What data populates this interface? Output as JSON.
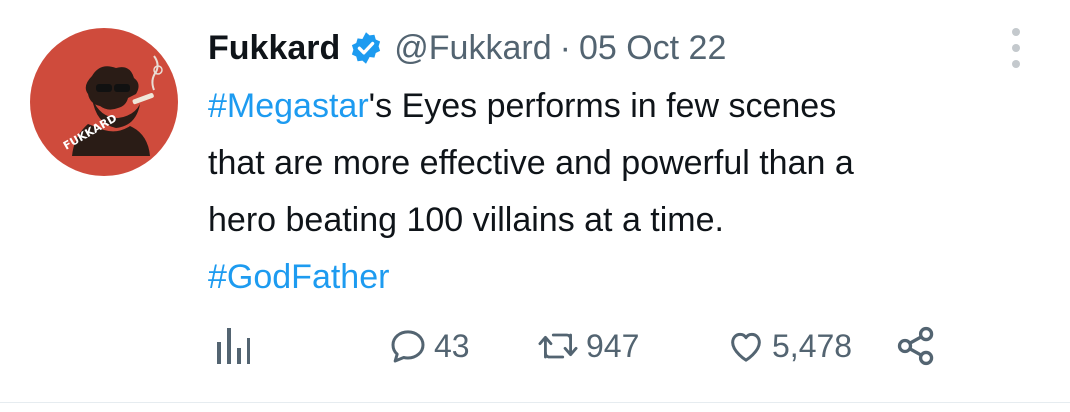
{
  "author": {
    "display_name": "Fukkard",
    "handle": "@Fukkard",
    "separator": "·",
    "date": "05 Oct 22",
    "avatar_logo_text": "FUKKARD",
    "verified": true
  },
  "tweet": {
    "segments": [
      {
        "text": "#Megastar",
        "type": "hashtag"
      },
      {
        "text": "'s Eyes performs in few scenes",
        "type": "text"
      },
      {
        "text": "that are more effective and powerful than a",
        "type": "text"
      },
      {
        "text": "hero beating 100 villains at a time.",
        "type": "text"
      },
      {
        "text": "#GodFather",
        "type": "hashtag"
      }
    ]
  },
  "actions": {
    "replies": "43",
    "retweets": "947",
    "likes": "5,478"
  },
  "icons": {
    "verified": "verified-badge-icon",
    "more": "more-options-icon",
    "views": "analytics-icon",
    "reply": "reply-icon",
    "retweet": "retweet-icon",
    "like": "heart-icon",
    "share": "share-icon"
  },
  "colors": {
    "hashtag": "#1d9bf0",
    "verified": "#1d9bf0",
    "secondary_text": "#536471",
    "avatar_bg": "#cf4b3c"
  }
}
